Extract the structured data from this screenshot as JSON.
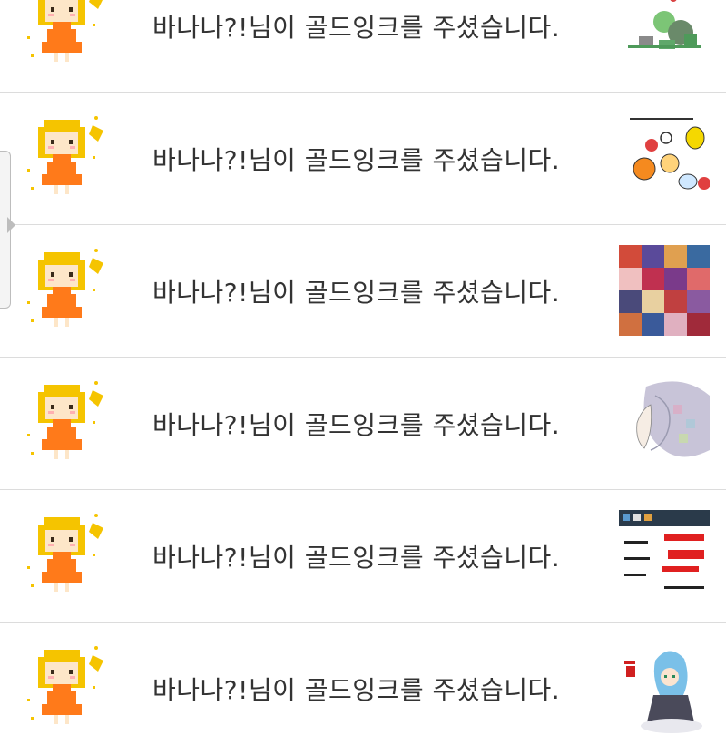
{
  "notifications": [
    {
      "message": "바나나?!님이 골드잉크를 주셨습니다.",
      "avatar_icon": "pixel-girl-avatar",
      "thumbnail": "drawing-thumbnail-1"
    },
    {
      "message": "바나나?!님이 골드잉크를 주셨습니다.",
      "avatar_icon": "pixel-girl-avatar",
      "thumbnail": "drawing-thumbnail-2"
    },
    {
      "message": "바나나?!님이 골드잉크를 주셨습니다.",
      "avatar_icon": "pixel-girl-avatar",
      "thumbnail": "drawing-thumbnail-3"
    },
    {
      "message": "바나나?!님이 골드잉크를 주셨습니다.",
      "avatar_icon": "pixel-girl-avatar",
      "thumbnail": "drawing-thumbnail-4"
    },
    {
      "message": "바나나?!님이 골드잉크를 주셨습니다.",
      "avatar_icon": "pixel-girl-avatar",
      "thumbnail": "drawing-thumbnail-5"
    },
    {
      "message": "바나나?!님이 골드잉크를 주셨습니다.",
      "avatar_icon": "pixel-girl-avatar",
      "thumbnail": "drawing-thumbnail-6"
    }
  ],
  "colors": {
    "text": "#333333",
    "divider": "#dcdcdc",
    "hair": "#f5c400",
    "dress": "#ff7a1a"
  }
}
